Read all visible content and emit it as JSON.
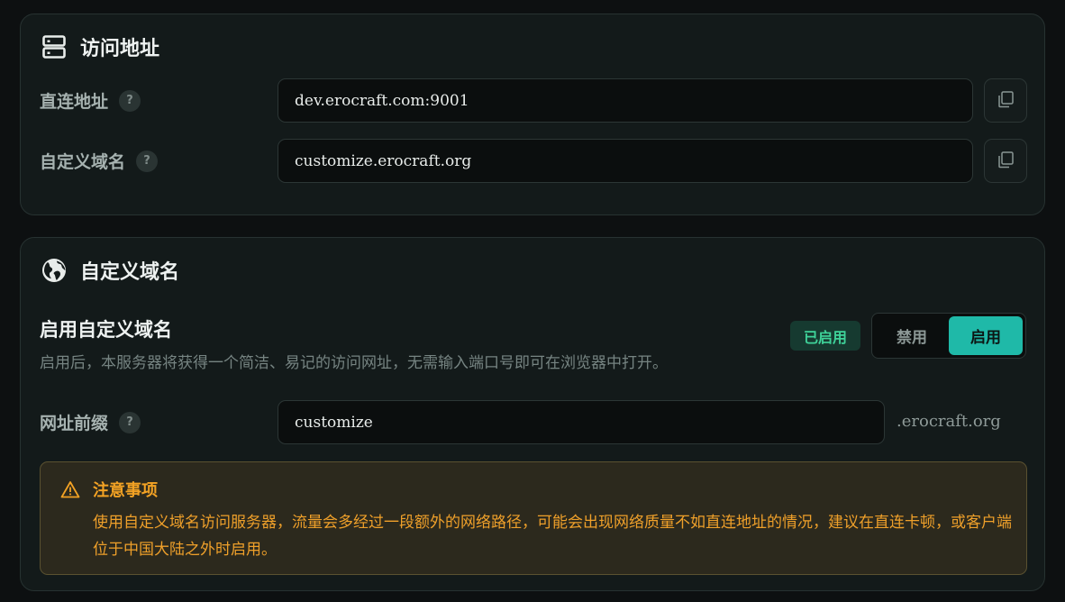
{
  "access": {
    "title": "访问地址",
    "icon": "server-icon",
    "direct": {
      "label": "直连地址",
      "value": "dev.erocraft.com:9001"
    },
    "custom": {
      "label": "自定义域名",
      "value": "customize.erocraft.org"
    },
    "help_glyph": "?"
  },
  "domain": {
    "title": "自定义域名",
    "icon": "globe-icon",
    "enable_title": "启用自定义域名",
    "enable_desc": "启用后，本服务器将获得一个简洁、易记的访问网址，无需输入端口号即可在浏览器中打开。",
    "status_badge": "已启用",
    "toggle": {
      "off_label": "禁用",
      "on_label": "启用",
      "selected": "启用"
    },
    "prefix": {
      "label": "网址前缀",
      "value": "customize",
      "suffix": ".erocraft.org"
    },
    "notice": {
      "title": "注意事项",
      "icon": "warning-icon",
      "body": "使用自定义域名访问服务器，流量会多经过一段额外的网络路径，可能会出现网络质量不如直连地址的情况，建议在直连卡顿，或客户端位于中国大陆之外时启用。"
    }
  },
  "colors": {
    "accent": "#1fb9a8",
    "success": "#3fd39a",
    "warning": "#f3a224",
    "background": "#0d1011",
    "card": "#131a1a"
  }
}
